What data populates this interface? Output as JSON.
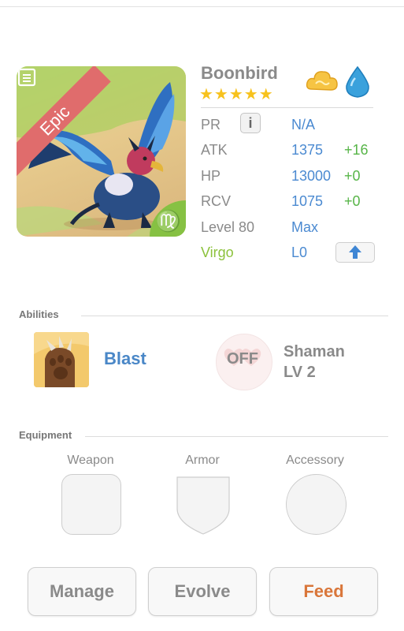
{
  "monster": {
    "name": "Boonbird",
    "stars": "★★★★★",
    "rarity": "Epic",
    "zodiac_symbol": "♍"
  },
  "stats": {
    "pr": {
      "label": "PR",
      "value": "N/A"
    },
    "atk": {
      "label": "ATK",
      "value": "1375",
      "bonus": "+16"
    },
    "hp": {
      "label": "HP",
      "value": "13000",
      "bonus": "+0"
    },
    "rcv": {
      "label": "RCV",
      "value": "1075",
      "bonus": "+0"
    },
    "level": {
      "label": "Level 80",
      "value": "Max"
    },
    "zodiac": {
      "label": "Virgo",
      "value": "L0"
    }
  },
  "info_button": "i",
  "abilities": {
    "title": "Abilities",
    "ability_name": "Blast",
    "toggle_state": "OFF",
    "passive_line1": "Shaman",
    "passive_line2": "LV 2"
  },
  "equipment": {
    "title": "Equipment",
    "weapon": "Weapon",
    "armor": "Armor",
    "accessory": "Accessory"
  },
  "actions": {
    "manage": "Manage",
    "evolve": "Evolve",
    "feed": "Feed"
  },
  "colors": {
    "accent_blue": "#4b8ad1",
    "bonus_green": "#57b548",
    "epic_red": "#e06c6c",
    "feed_orange": "#d9763a"
  },
  "icons": {
    "element_1": "cloud-icon",
    "element_2": "water-drop-icon",
    "upgrade": "arrow-up-icon",
    "card": "card-list-icon"
  }
}
